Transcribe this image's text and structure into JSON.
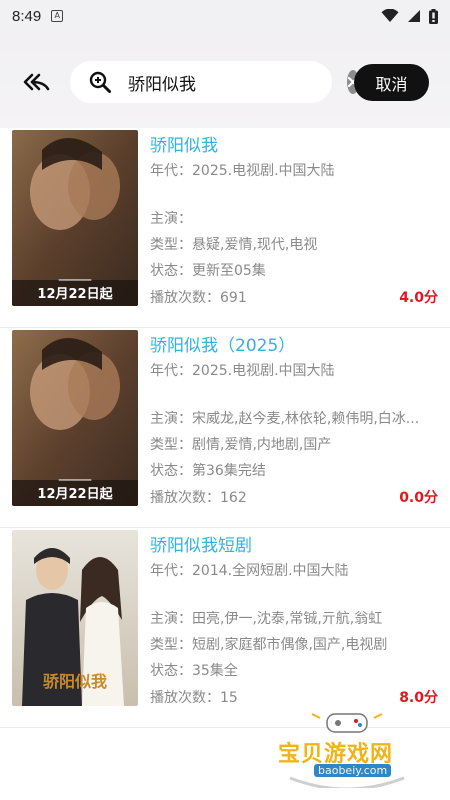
{
  "status_bar": {
    "time": "8:49",
    "notification_glyph": "A"
  },
  "header": {
    "search": {
      "query": "骄阳似我"
    },
    "cancel_label": "取消"
  },
  "results": [
    {
      "title": "骄阳似我",
      "year": "年代：2025.电视剧.中国大陆",
      "cast": "主演：",
      "genre": "类型：悬疑,爱情,现代,电视",
      "status": "状态：更新至05集",
      "plays": "播放次数：691",
      "score": "4.0分",
      "poster_caption": "12月22日起"
    },
    {
      "title": "骄阳似我（2025）",
      "year": "年代：2025.电视剧.中国大陆",
      "cast": "主演：宋威龙,赵今麦,林依轮,赖伟明,白冰...",
      "genre": "类型：剧情,爱情,内地剧,国产",
      "status": "状态：第36集完结",
      "plays": "播放次数：162",
      "score": "0.0分",
      "poster_caption": "12月22日起"
    },
    {
      "title": "骄阳似我短剧",
      "year": "年代：2014.全网短剧.中国大陆",
      "cast": "主演：田亮,伊一,沈泰,常铖,亓航,翁虹",
      "genre": "类型：短剧,家庭都市偶像,国产,电视剧",
      "status": "状态：35集全",
      "plays": "播放次数：15",
      "score": "8.0分",
      "poster_caption": "骄阳似我"
    }
  ],
  "watermark": {
    "text": "宝贝游戏网",
    "url": "baobeiy.com"
  },
  "colors": {
    "title": "#2fb3e0",
    "score": "#e0191e",
    "meta": "#8a8a8a",
    "cancel_bg": "#111111"
  }
}
